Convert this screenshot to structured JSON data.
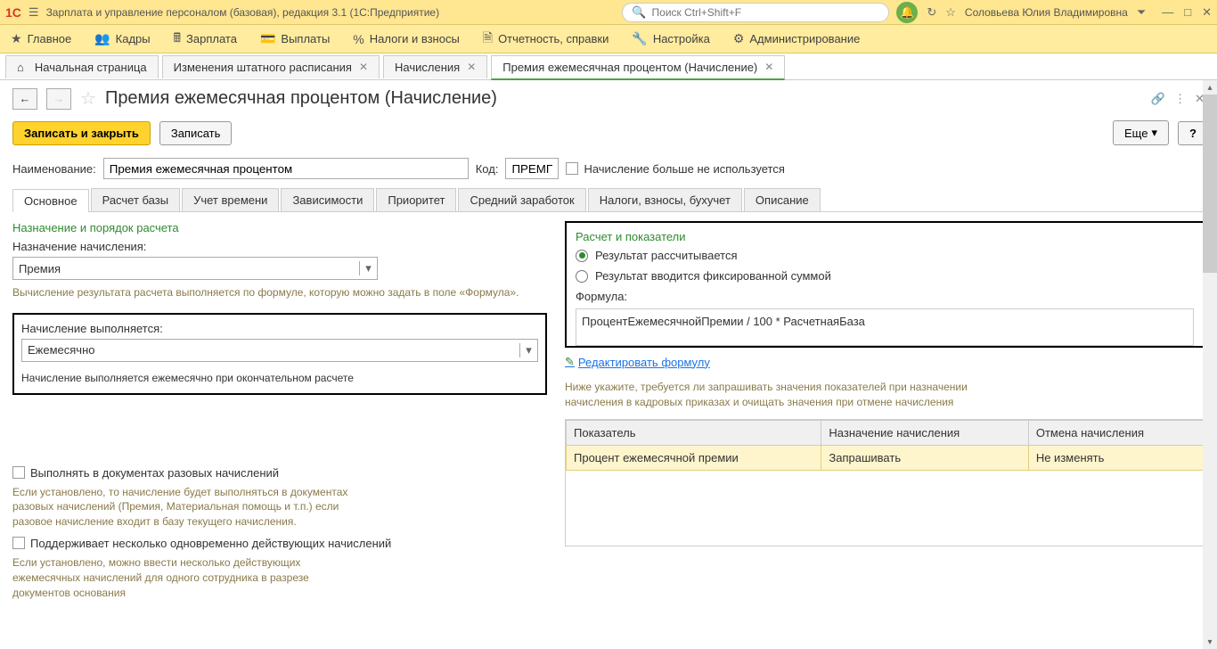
{
  "app": {
    "title": "Зарплата и управление персоналом (базовая), редакция 3.1  (1С:Предприятие)",
    "search_placeholder": "Поиск Ctrl+Shift+F",
    "user": "Соловьева Юлия Владимировна"
  },
  "nav": {
    "items": [
      {
        "label": "Главное"
      },
      {
        "label": "Кадры"
      },
      {
        "label": "Зарплата"
      },
      {
        "label": "Выплаты"
      },
      {
        "label": "Налоги и взносы"
      },
      {
        "label": "Отчетность, справки"
      },
      {
        "label": "Настройка"
      },
      {
        "label": "Администрирование"
      }
    ]
  },
  "tabs": [
    {
      "label": "Начальная страница",
      "closable": false
    },
    {
      "label": "Изменения штатного расписания",
      "closable": true
    },
    {
      "label": "Начисления",
      "closable": true
    },
    {
      "label": "Премия ежемесячная процентом (Начисление)",
      "closable": true,
      "active": true
    }
  ],
  "doc": {
    "title": "Премия ежемесячная процентом (Начисление)",
    "save_close": "Записать и закрыть",
    "save": "Записать",
    "more": "Еще",
    "name_label": "Наименование:",
    "name_value": "Премия ежемесячная процентом",
    "code_label": "Код:",
    "code_value": "ПРЕМП",
    "not_used": "Начисление больше не используется"
  },
  "inner_tabs": [
    "Основное",
    "Расчет базы",
    "Учет времени",
    "Зависимости",
    "Приоритет",
    "Средний заработок",
    "Налоги, взносы, бухучет",
    "Описание"
  ],
  "left": {
    "section1": "Назначение и порядок расчета",
    "assign_label": "Назначение начисления:",
    "assign_value": "Премия",
    "assign_hint": "Вычисление результата расчета выполняется по формуле, которую можно задать в поле «Формула».",
    "exec_label": "Начисление выполняется:",
    "exec_value": "Ежемесячно",
    "exec_hint": "Начисление выполняется ежемесячно при окончательном расчете",
    "cb1": "Выполнять в документах разовых начислений",
    "cb1_hint": "Если установлено, то начисление будет выполняться в документах разовых начислений (Премия, Материальная помощь и т.п.) если разовое начисление входит в базу текущего начисления.",
    "cb2": "Поддерживает несколько одновременно действующих начислений",
    "cb2_hint": "Если установлено, можно ввести несколько действующих ежемесячных начислений для одного сотрудника в разрезе документов основания"
  },
  "right": {
    "section": "Расчет и показатели",
    "radio1": "Результат рассчитывается",
    "radio2": "Результат вводится фиксированной суммой",
    "formula_label": "Формула:",
    "formula": "ПроцентЕжемесячнойПремии / 100 * РасчетнаяБаза",
    "edit_link": "Редактировать формулу",
    "hint": "Ниже укажите, требуется ли запрашивать значения показателей при назначении начисления в кадровых приказах и очищать значения при отмене начисления",
    "th1": "Показатель",
    "th2": "Назначение начисления",
    "th3": "Отмена начисления",
    "td1": "Процент ежемесячной премии",
    "td2": "Запрашивать",
    "td3": "Не изменять"
  }
}
